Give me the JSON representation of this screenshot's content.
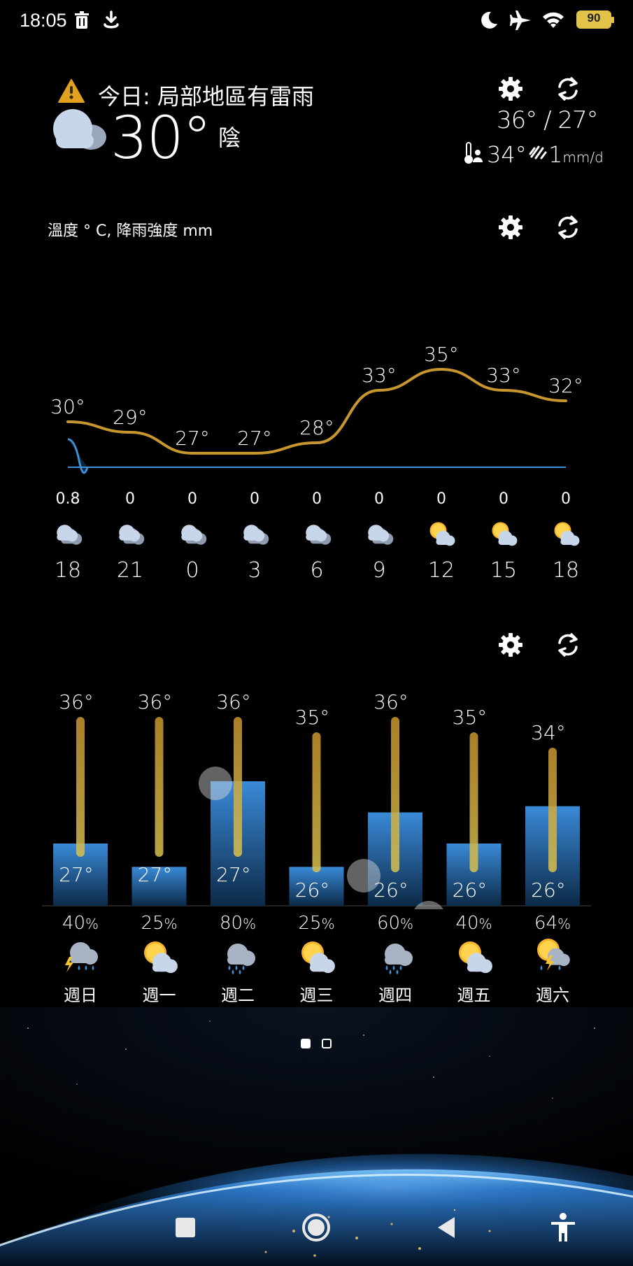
{
  "status_bar": {
    "time": "18:05",
    "left_icons": [
      "trash-icon",
      "download-icon"
    ],
    "right_icons": [
      "moon-icon",
      "airplane-icon",
      "wifi-icon",
      "battery-icon"
    ],
    "battery": "90"
  },
  "current": {
    "warning": "今日: 局部地區有雷雨",
    "temperature": "30°",
    "condition": "陰",
    "high_low": "36° / 27°",
    "feels_like": "34°",
    "rain_value": "1",
    "rain_unit": "mm/d"
  },
  "hourly": {
    "label": "溫度 ° C, 降雨強度 mm",
    "temps": [
      30,
      29,
      27,
      27,
      28,
      33,
      35,
      33,
      32
    ],
    "temp_labels": [
      "30°",
      "29°",
      "27°",
      "27°",
      "28°",
      "33°",
      "35°",
      "33°",
      "32°"
    ],
    "precip": [
      "0.8",
      "0",
      "0",
      "0",
      "0",
      "0",
      "0",
      "0",
      "0"
    ],
    "hours": [
      "18",
      "21",
      "0",
      "3",
      "6",
      "9",
      "12",
      "15",
      "18"
    ],
    "icons": [
      "cloud-icon",
      "cloud-icon",
      "cloud-icon",
      "cloud-icon",
      "cloud-icon",
      "cloud-icon",
      "sun-cloud-icon",
      "sun-cloud-icon",
      "sun-cloud-icon"
    ]
  },
  "daily": {
    "days": [
      "週日",
      "週一",
      "週二",
      "週三",
      "週四",
      "週五",
      "週六"
    ],
    "highs": [
      "36°",
      "36°",
      "36°",
      "35°",
      "36°",
      "35°",
      "34°"
    ],
    "lows": [
      "27°",
      "27°",
      "27°",
      "26°",
      "26°",
      "26°",
      "26°"
    ],
    "pops": [
      "40",
      "25",
      "80",
      "25",
      "60",
      "40",
      "64"
    ],
    "pop_unit": "%",
    "icons": [
      "thunder-rain-icon",
      "sun-cloud-icon",
      "rain-icon",
      "sun-cloud-icon",
      "rain-icon",
      "sun-cloud-icon",
      "sun-thunder-icon"
    ]
  },
  "chart_data": [
    {
      "type": "line",
      "title": "溫度 ° C, 降雨強度 mm",
      "x": [
        "18",
        "21",
        "0",
        "3",
        "6",
        "9",
        "12",
        "15",
        "18"
      ],
      "series": [
        {
          "values": [
            30,
            29,
            27,
            27,
            28,
            33,
            35,
            33,
            32
          ]
        },
        {
          "values": [
            0.8,
            0,
            0,
            0,
            0,
            0,
            0,
            0,
            0
          ]
        }
      ]
    },
    {
      "type": "bar",
      "categories": [
        "週日",
        "週一",
        "週二",
        "週三",
        "週四",
        "週五",
        "週六"
      ],
      "series": [
        {
          "values": [
            36,
            36,
            36,
            35,
            36,
            35,
            34
          ]
        },
        {
          "values": [
            27,
            27,
            27,
            26,
            26,
            26,
            26
          ]
        },
        {
          "values": [
            40,
            25,
            80,
            25,
            60,
            40,
            64
          ]
        }
      ]
    }
  ],
  "colors": {
    "temp_line": "#c8962e",
    "precip_line": "#3d8fd6",
    "bar_blue": "#3a8ad8",
    "warning": "#e0a020",
    "battery": "#e3c24a"
  },
  "page_indicator": {
    "pages": 2,
    "active": 0
  },
  "nav": [
    "recents-button",
    "home-button",
    "back-button",
    "accessibility-button"
  ]
}
